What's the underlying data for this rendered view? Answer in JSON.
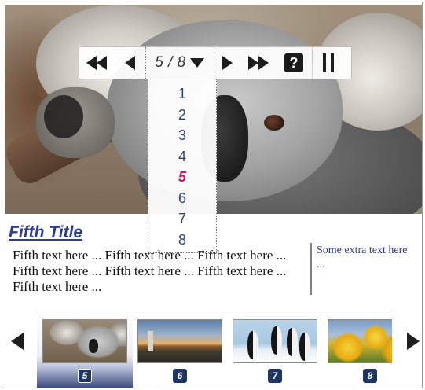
{
  "slideshow": {
    "current_slide": 5,
    "total_slides": 8,
    "counter_text": "5 / 8",
    "pages": [
      "1",
      "2",
      "3",
      "4",
      "5",
      "6",
      "7",
      "8"
    ],
    "current_page_index": 4
  },
  "caption": {
    "title": "Fifth Title",
    "text": "Fifth text here ... Fifth text here ... Fifth text here ... Fifth text here ... Fifth text here ... Fifth text here ... Fifth text here ...",
    "extra": "Some extra text here ..."
  },
  "controls": {
    "first_icon": "double-left-arrow-icon",
    "prev_icon": "left-arrow-icon",
    "dropdown_icon": "down-triangle-icon",
    "next_icon": "right-arrow-icon",
    "last_icon": "double-right-arrow-icon",
    "help_label": "?",
    "pause_icon": "pause-icon"
  },
  "thumbnails": [
    {
      "number": "5",
      "subject": "koala",
      "active": true
    },
    {
      "number": "6",
      "subject": "lighthouse at sunset",
      "active": false
    },
    {
      "number": "7",
      "subject": "penguins",
      "active": false
    },
    {
      "number": "8",
      "subject": "yellow tulips",
      "active": false
    }
  ],
  "colors": {
    "title": "#2e3d8f",
    "current_page": "#c2185b",
    "page_link": "#2a3f73",
    "active_thumb_bottom": "#2e3f74",
    "badge": "#1f3564"
  }
}
